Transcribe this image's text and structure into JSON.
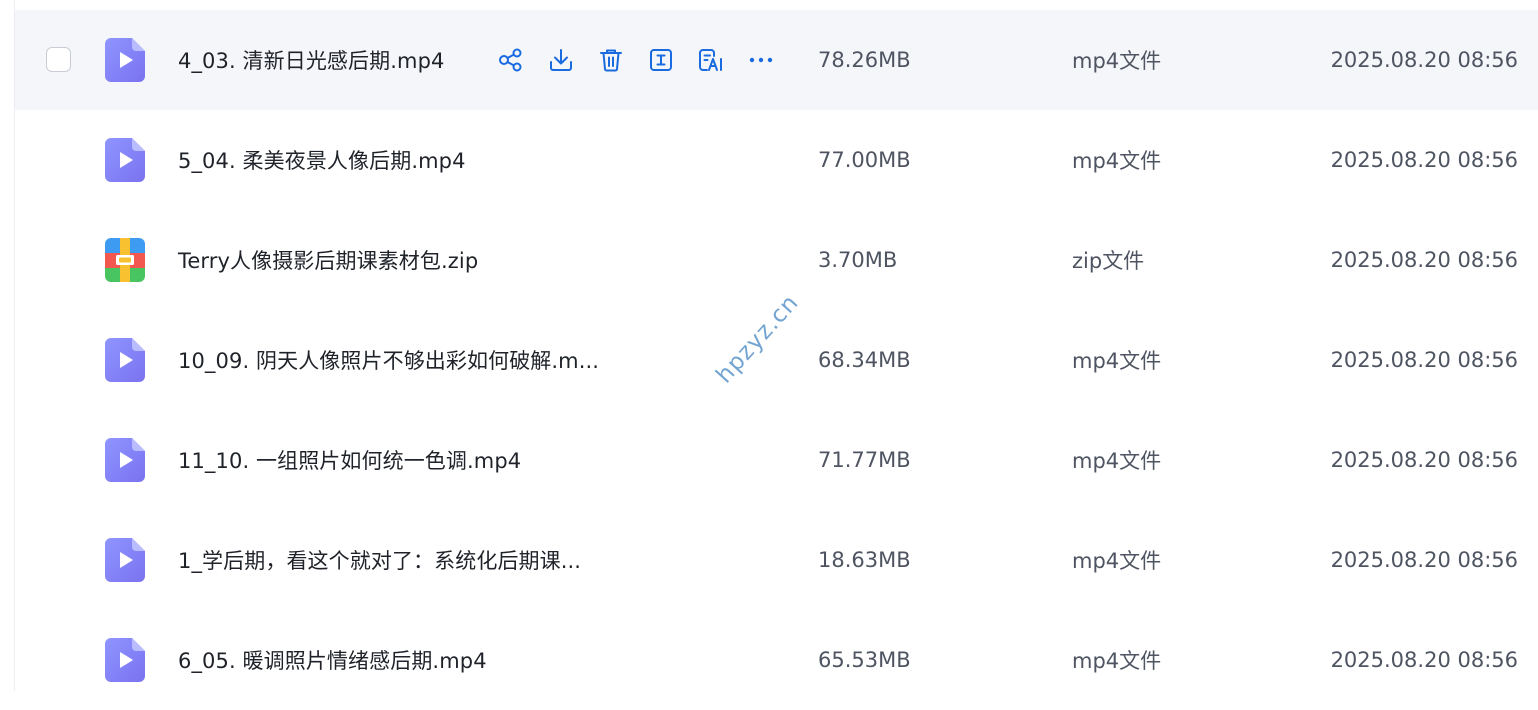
{
  "accent_color": "#1a6be0",
  "watermark": "hpzyz.cn",
  "hover_actions": [
    {
      "name": "share-icon",
      "label": "share"
    },
    {
      "name": "download-icon",
      "label": "download"
    },
    {
      "name": "delete-icon",
      "label": "delete"
    },
    {
      "name": "rename-icon",
      "label": "rename"
    },
    {
      "name": "ai-text-icon",
      "label": "ai"
    },
    {
      "name": "more-icon",
      "label": "more"
    }
  ],
  "files": [
    {
      "name": "4_03. 清新日光感后期.mp4",
      "size": "78.26MB",
      "type": "mp4文件",
      "date": "2025.08.20 08:56",
      "icon": "video-file-icon"
    },
    {
      "name": "5_04. 柔美夜景人像后期.mp4",
      "size": "77.00MB",
      "type": "mp4文件",
      "date": "2025.08.20 08:56",
      "icon": "video-file-icon"
    },
    {
      "name": "Terry人像摄影后期课素材包.zip",
      "size": "3.70MB",
      "type": "zip文件",
      "date": "2025.08.20 08:56",
      "icon": "zip-file-icon"
    },
    {
      "name": "10_09. 阴天人像照片不够出彩如何破解.m...",
      "size": "68.34MB",
      "type": "mp4文件",
      "date": "2025.08.20 08:56",
      "icon": "video-file-icon"
    },
    {
      "name": "11_10. 一组照片如何统一色调.mp4",
      "size": "71.77MB",
      "type": "mp4文件",
      "date": "2025.08.20 08:56",
      "icon": "video-file-icon"
    },
    {
      "name": "1_学后期，看这个就对了：系统化后期课...",
      "size": "18.63MB",
      "type": "mp4文件",
      "date": "2025.08.20 08:56",
      "icon": "video-file-icon"
    },
    {
      "name": "6_05. 暖调照片情绪感后期.mp4",
      "size": "65.53MB",
      "type": "mp4文件",
      "date": "2025.08.20 08:56",
      "icon": "video-file-icon"
    }
  ]
}
